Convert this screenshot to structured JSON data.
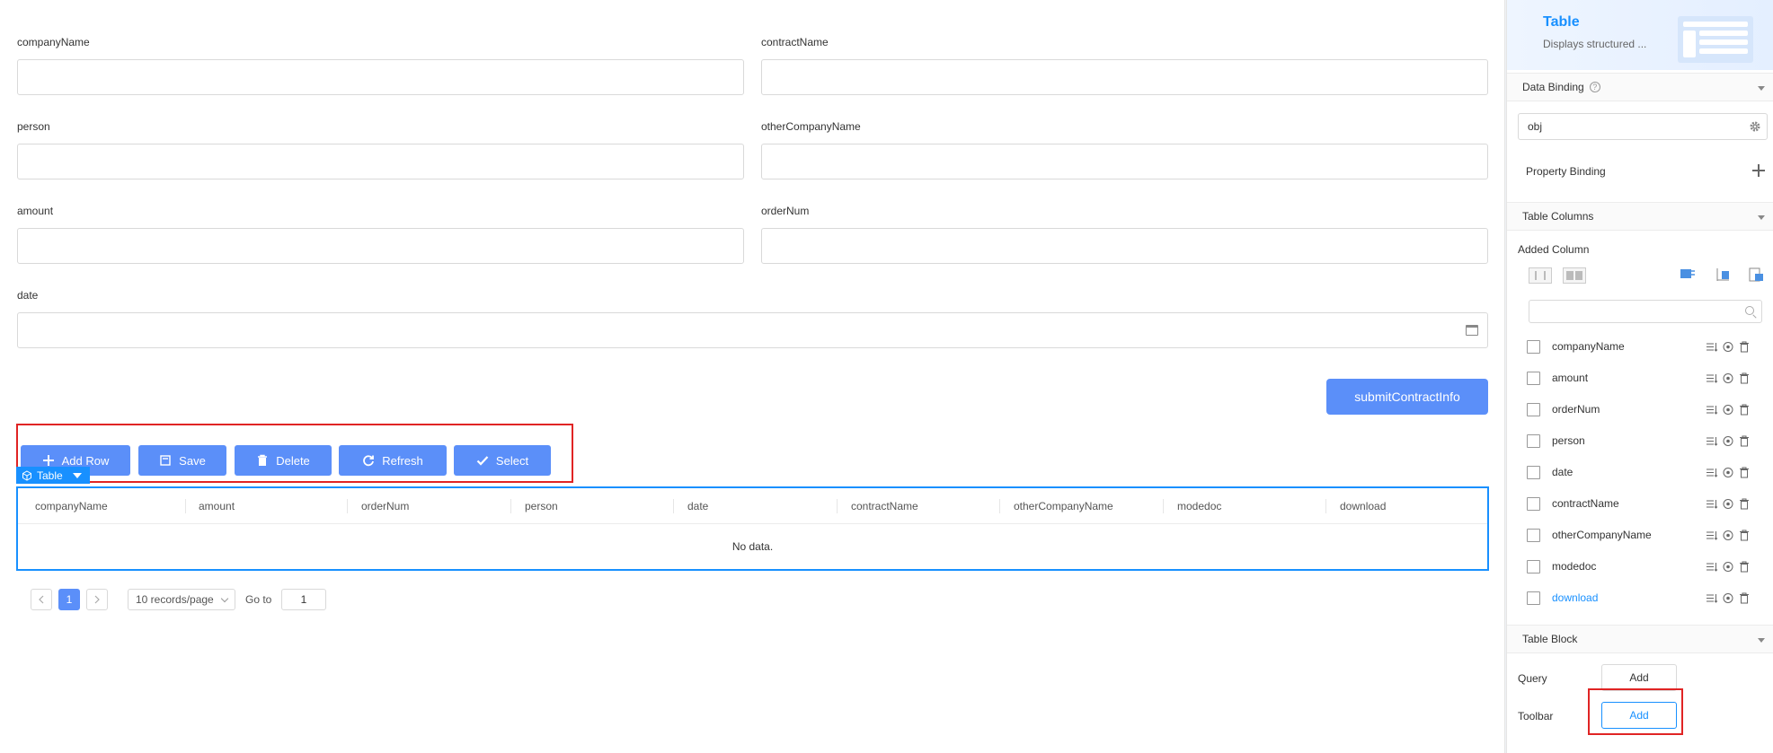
{
  "form": {
    "fields": {
      "companyName": "companyName",
      "contractName": "contractName",
      "person": "person",
      "otherCompanyName": "otherCompanyName",
      "amount": "amount",
      "orderNum": "orderNum",
      "date": "date"
    },
    "submit_label": "submitContractInfo"
  },
  "toolbar": {
    "add_row": "Add Row",
    "save": "Save",
    "delete": "Delete",
    "refresh": "Refresh",
    "select": "Select"
  },
  "table": {
    "tag_label": "Table",
    "columns": [
      "companyName",
      "amount",
      "orderNum",
      "person",
      "date",
      "contractName",
      "otherCompanyName",
      "modedoc",
      "download"
    ],
    "empty_text": "No data."
  },
  "pager": {
    "current_page": "1",
    "page_size": "10 records/page",
    "goto_label": "Go to",
    "goto_value": "1"
  },
  "panel": {
    "title": "Table",
    "subtitle": "Displays structured ...",
    "data_binding": {
      "header": "Data Binding",
      "value": "obj",
      "property_binding": "Property Binding"
    },
    "table_columns": {
      "header": "Table Columns",
      "added_label": "Added Column",
      "items": [
        {
          "name": "companyName"
        },
        {
          "name": "amount"
        },
        {
          "name": "orderNum"
        },
        {
          "name": "person"
        },
        {
          "name": "date"
        },
        {
          "name": "contractName"
        },
        {
          "name": "otherCompanyName"
        },
        {
          "name": "modedoc"
        },
        {
          "name": "download"
        }
      ]
    },
    "table_block": {
      "header": "Table Block",
      "query_label": "Query",
      "query_button": "Add",
      "toolbar_label": "Toolbar",
      "toolbar_button": "Add"
    }
  },
  "colors": {
    "primary": "#5b8ff9",
    "accent": "#1890ff",
    "highlight": "#e02424"
  }
}
